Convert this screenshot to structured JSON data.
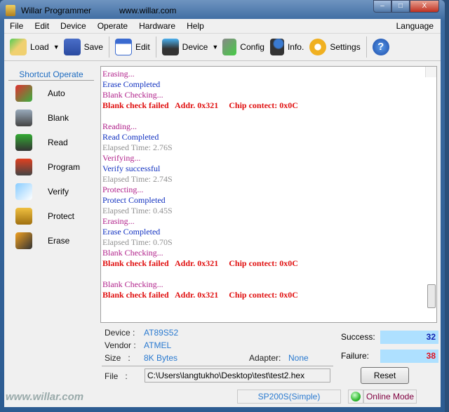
{
  "window": {
    "title": "Willar Programmer",
    "url": "www.willar.com",
    "minimize": "–",
    "maximize": "□",
    "close": "X"
  },
  "menu": [
    "File",
    "Edit",
    "Device",
    "Operate",
    "Hardware",
    "Help"
  ],
  "menu_language": "Language",
  "toolbar": {
    "load": "Load",
    "save": "Save",
    "edit": "Edit",
    "device": "Device",
    "config": "Config",
    "info": "Info.",
    "settings": "Settings",
    "dropdown": "▼",
    "help": "?"
  },
  "shortcut": {
    "title": "Shortcut Operate",
    "items": [
      "Auto",
      "Blank",
      "Read",
      "Program",
      "Verify",
      "Protect",
      "Erase"
    ]
  },
  "log": [
    {
      "t": "Erasing...",
      "c": "p"
    },
    {
      "t": "Erase Completed",
      "c": "b"
    },
    {
      "t": "Blank Checking...",
      "c": "p"
    },
    {
      "t": "Blank check failed   Addr. 0x321     Chip contect: 0x0C",
      "c": "r"
    },
    {
      "t": "",
      "c": "g"
    },
    {
      "t": "Reading...",
      "c": "p"
    },
    {
      "t": "Read Completed",
      "c": "b"
    },
    {
      "t": "Elapsed Time: 2.76S",
      "c": "g"
    },
    {
      "t": "Verifying...",
      "c": "p"
    },
    {
      "t": "Verify successful",
      "c": "b"
    },
    {
      "t": "Elapsed Time: 2.74S",
      "c": "g"
    },
    {
      "t": "Protecting...",
      "c": "p"
    },
    {
      "t": "Protect Completed",
      "c": "b"
    },
    {
      "t": "Elapsed Time: 0.45S",
      "c": "g"
    },
    {
      "t": "Erasing...",
      "c": "p"
    },
    {
      "t": "Erase Completed",
      "c": "b"
    },
    {
      "t": "Elapsed Time: 0.70S",
      "c": "g"
    },
    {
      "t": "Blank Checking...",
      "c": "p"
    },
    {
      "t": "Blank check failed   Addr. 0x321     Chip contect: 0x0C",
      "c": "r"
    },
    {
      "t": "",
      "c": "g"
    },
    {
      "t": "Blank Checking...",
      "c": "p"
    },
    {
      "t": "Blank check failed   Addr. 0x321     Chip contect: 0x0C",
      "c": "r"
    }
  ],
  "info": {
    "device_label": "Device :",
    "device": "AT89S52",
    "vendor_label": "Vendor :",
    "vendor": "ATMEL",
    "size_label": "Size   :",
    "size": "8K Bytes",
    "adapter_label": "Adapter:",
    "adapter": "None",
    "file_label": "File   :",
    "file": "C:\\Users\\langtukho\\Desktop\\test\\test2.hex"
  },
  "stats": {
    "success_label": "Success:",
    "success": "32",
    "failure_label": "Failure:",
    "failure": "38",
    "reset": "Reset"
  },
  "status": {
    "brand": "www.willar.com",
    "programmer": "SP200S(Simple)",
    "mode": "Online Mode"
  }
}
